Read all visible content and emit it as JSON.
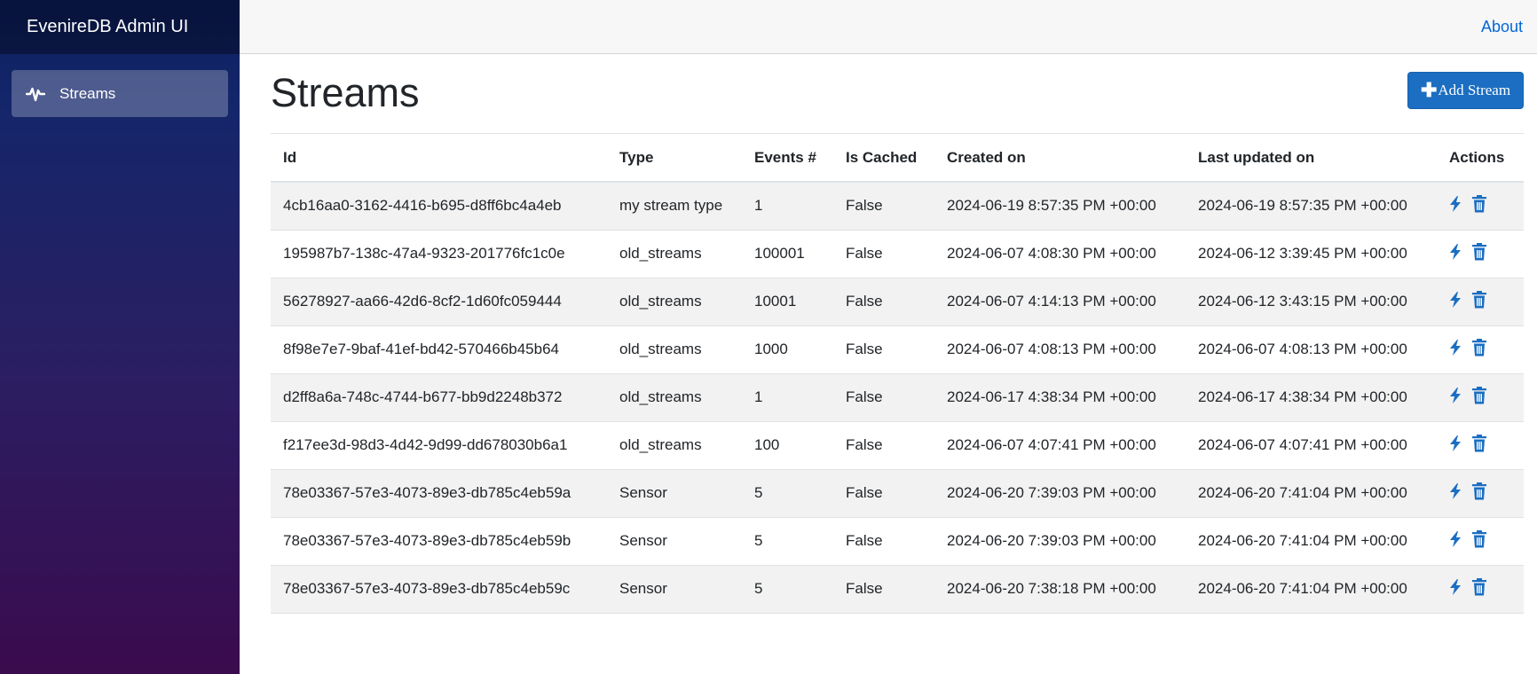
{
  "app": {
    "brand": "EvenireDB Admin UI"
  },
  "sidebar": {
    "items": [
      {
        "label": "Streams",
        "icon": "pulse-icon"
      }
    ]
  },
  "topbar": {
    "about_label": "About"
  },
  "page": {
    "title": "Streams",
    "add_button_label": "Add Stream",
    "add_button_icon": "plus-icon"
  },
  "colors": {
    "accent": "#1b6ec2",
    "link": "#0366d6",
    "sidebar_top": "#0b1f5e",
    "sidebar_bottom": "#3a0b4e"
  },
  "table": {
    "columns": [
      "Id",
      "Type",
      "Events #",
      "Is Cached",
      "Created on",
      "Last updated on",
      "Actions"
    ],
    "action_icons": [
      "bolt-icon",
      "trash-icon"
    ],
    "rows": [
      {
        "id": "4cb16aa0-3162-4416-b695-d8ff6bc4a4eb",
        "type": "my stream type",
        "events": "1",
        "cached": "False",
        "created": "2024-06-19 8:57:35 PM +00:00",
        "updated": "2024-06-19 8:57:35 PM +00:00"
      },
      {
        "id": "195987b7-138c-47a4-9323-201776fc1c0e",
        "type": "old_streams",
        "events": "100001",
        "cached": "False",
        "created": "2024-06-07 4:08:30 PM +00:00",
        "updated": "2024-06-12 3:39:45 PM +00:00"
      },
      {
        "id": "56278927-aa66-42d6-8cf2-1d60fc059444",
        "type": "old_streams",
        "events": "10001",
        "cached": "False",
        "created": "2024-06-07 4:14:13 PM +00:00",
        "updated": "2024-06-12 3:43:15 PM +00:00"
      },
      {
        "id": "8f98e7e7-9baf-41ef-bd42-570466b45b64",
        "type": "old_streams",
        "events": "1000",
        "cached": "False",
        "created": "2024-06-07 4:08:13 PM +00:00",
        "updated": "2024-06-07 4:08:13 PM +00:00"
      },
      {
        "id": "d2ff8a6a-748c-4744-b677-bb9d2248b372",
        "type": "old_streams",
        "events": "1",
        "cached": "False",
        "created": "2024-06-17 4:38:34 PM +00:00",
        "updated": "2024-06-17 4:38:34 PM +00:00"
      },
      {
        "id": "f217ee3d-98d3-4d42-9d99-dd678030b6a1",
        "type": "old_streams",
        "events": "100",
        "cached": "False",
        "created": "2024-06-07 4:07:41 PM +00:00",
        "updated": "2024-06-07 4:07:41 PM +00:00"
      },
      {
        "id": "78e03367-57e3-4073-89e3-db785c4eb59a",
        "type": "Sensor",
        "events": "5",
        "cached": "False",
        "created": "2024-06-20 7:39:03 PM +00:00",
        "updated": "2024-06-20 7:41:04 PM +00:00"
      },
      {
        "id": "78e03367-57e3-4073-89e3-db785c4eb59b",
        "type": "Sensor",
        "events": "5",
        "cached": "False",
        "created": "2024-06-20 7:39:03 PM +00:00",
        "updated": "2024-06-20 7:41:04 PM +00:00"
      },
      {
        "id": "78e03367-57e3-4073-89e3-db785c4eb59c",
        "type": "Sensor",
        "events": "5",
        "cached": "False",
        "created": "2024-06-20 7:38:18 PM +00:00",
        "updated": "2024-06-20 7:41:04 PM +00:00"
      }
    ]
  }
}
